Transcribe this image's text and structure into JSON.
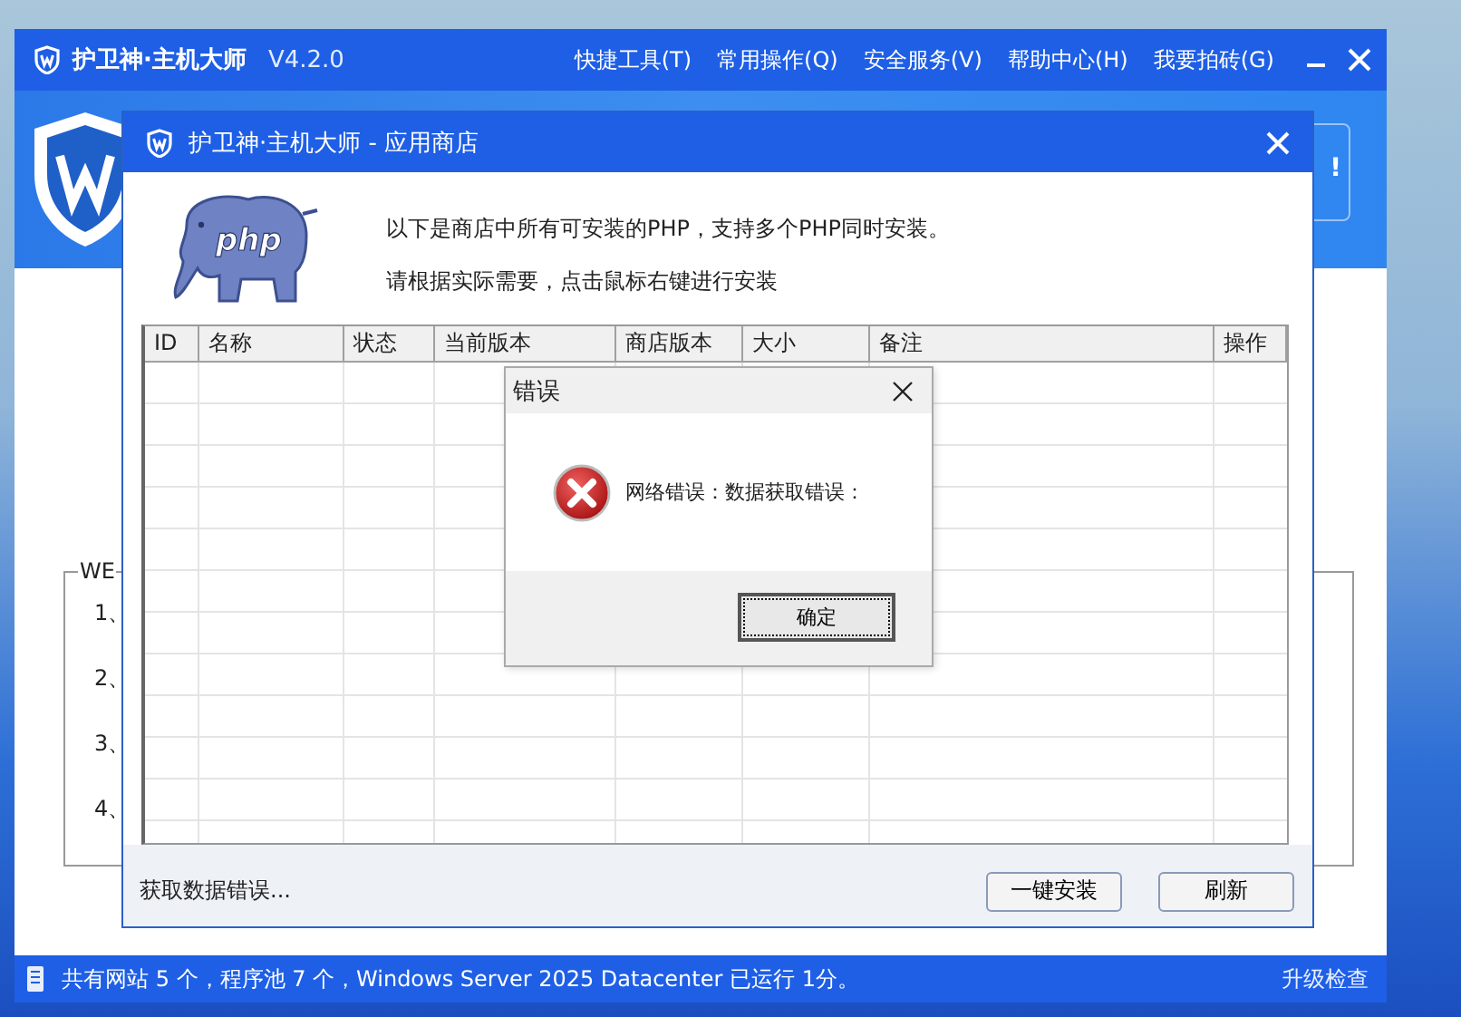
{
  "main_window": {
    "title": "护卫神·主机大师",
    "version": "V4.2.0",
    "menu": [
      "快捷工具(T)",
      "常用操作(Q)",
      "安全服务(V)",
      "帮助中心(H)",
      "我要拍砖(G)"
    ],
    "banner_notice": "!",
    "group": {
      "title": "WE",
      "items": [
        "1、",
        "2、",
        "3、",
        "4、"
      ]
    },
    "status_bar": {
      "text": "共有网站 5 个，程序池 7 个，Windows Server 2025 Datacenter 已运行 1分。",
      "link": "升级检查"
    }
  },
  "store_window": {
    "title": "护卫神·主机大师 - 应用商店",
    "logo_text": "php",
    "intro": [
      "以下是商店中所有可安装的PHP，支持多个PHP同时安装。",
      "请根据实际需要，点击鼠标右键进行安装"
    ],
    "table": {
      "columns": [
        "ID",
        "名称",
        "状态",
        "当前版本",
        "商店版本",
        "大小",
        "备注",
        "操作"
      ]
    },
    "status": "获取数据错误...",
    "buttons": [
      "一键安装",
      "刷新"
    ]
  },
  "dialog": {
    "title": "错误",
    "message": "网络错误：数据获取错误：",
    "buttons": [
      {
        "label": "确定",
        "focused": true
      }
    ]
  }
}
